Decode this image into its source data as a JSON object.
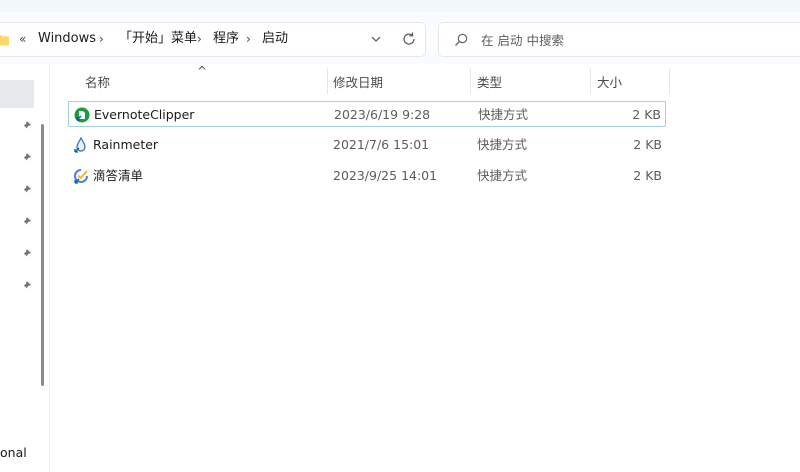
{
  "breadcrumb": {
    "overflow": "«",
    "items": [
      "Windows",
      "「开始」菜单",
      "程序",
      "启动"
    ],
    "separator": "›"
  },
  "search": {
    "placeholder": "在 启动 中搜索"
  },
  "nav": {
    "partial_label": "onal"
  },
  "columns": {
    "name": "名称",
    "date": "修改日期",
    "type": "类型",
    "size": "大小"
  },
  "files": [
    {
      "name": "EvernoteClipper",
      "date": "2023/6/19 9:28",
      "type": "快捷方式",
      "size": "2 KB",
      "icon": "evernote-icon",
      "selected": true
    },
    {
      "name": "Rainmeter",
      "date": "2021/7/6 15:01",
      "type": "快捷方式",
      "size": "2 KB",
      "icon": "rainmeter-icon",
      "selected": false
    },
    {
      "name": "滴答清单",
      "date": "2023/9/25 14:01",
      "type": "快捷方式",
      "size": "2 KB",
      "icon": "ticktick-icon",
      "selected": false
    }
  ],
  "colors": {
    "selection_border": "#9fd0e0",
    "nav_selected": "#e7e9ec",
    "evernote_green": "#1e9b3c"
  }
}
